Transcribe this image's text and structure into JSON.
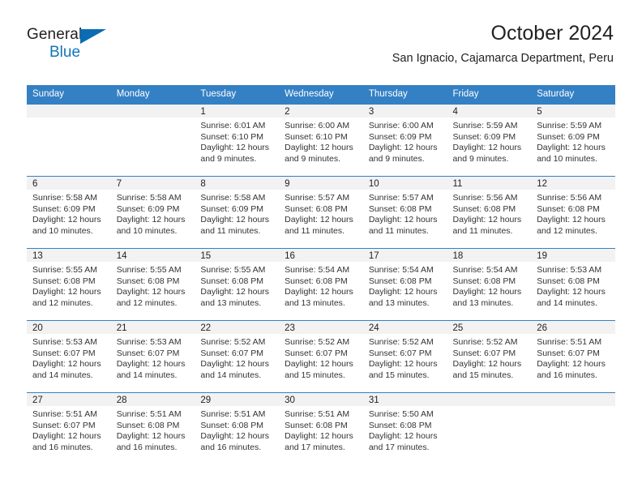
{
  "brand": {
    "name_primary": "General",
    "name_secondary": "Blue",
    "triangle_color": "#0a6cb4",
    "secondary_color": "#1175bc"
  },
  "header": {
    "title": "October 2024",
    "subtitle": "San Ignacio, Cajamarca Department, Peru"
  },
  "theme": {
    "header_blue": "#3480c4",
    "daynum_band": "#f2f2f2",
    "text": "#333333"
  },
  "weekday_headers": [
    "Sunday",
    "Monday",
    "Tuesday",
    "Wednesday",
    "Thursday",
    "Friday",
    "Saturday"
  ],
  "weeks": [
    [
      {
        "day": "",
        "sunrise": "",
        "sunset": "",
        "daylight_1": "",
        "daylight_2": ""
      },
      {
        "day": "",
        "sunrise": "",
        "sunset": "",
        "daylight_1": "",
        "daylight_2": ""
      },
      {
        "day": "1",
        "sunrise": "Sunrise: 6:01 AM",
        "sunset": "Sunset: 6:10 PM",
        "daylight_1": "Daylight: 12 hours",
        "daylight_2": "and 9 minutes."
      },
      {
        "day": "2",
        "sunrise": "Sunrise: 6:00 AM",
        "sunset": "Sunset: 6:10 PM",
        "daylight_1": "Daylight: 12 hours",
        "daylight_2": "and 9 minutes."
      },
      {
        "day": "3",
        "sunrise": "Sunrise: 6:00 AM",
        "sunset": "Sunset: 6:09 PM",
        "daylight_1": "Daylight: 12 hours",
        "daylight_2": "and 9 minutes."
      },
      {
        "day": "4",
        "sunrise": "Sunrise: 5:59 AM",
        "sunset": "Sunset: 6:09 PM",
        "daylight_1": "Daylight: 12 hours",
        "daylight_2": "and 9 minutes."
      },
      {
        "day": "5",
        "sunrise": "Sunrise: 5:59 AM",
        "sunset": "Sunset: 6:09 PM",
        "daylight_1": "Daylight: 12 hours",
        "daylight_2": "and 10 minutes."
      }
    ],
    [
      {
        "day": "6",
        "sunrise": "Sunrise: 5:58 AM",
        "sunset": "Sunset: 6:09 PM",
        "daylight_1": "Daylight: 12 hours",
        "daylight_2": "and 10 minutes."
      },
      {
        "day": "7",
        "sunrise": "Sunrise: 5:58 AM",
        "sunset": "Sunset: 6:09 PM",
        "daylight_1": "Daylight: 12 hours",
        "daylight_2": "and 10 minutes."
      },
      {
        "day": "8",
        "sunrise": "Sunrise: 5:58 AM",
        "sunset": "Sunset: 6:09 PM",
        "daylight_1": "Daylight: 12 hours",
        "daylight_2": "and 11 minutes."
      },
      {
        "day": "9",
        "sunrise": "Sunrise: 5:57 AM",
        "sunset": "Sunset: 6:08 PM",
        "daylight_1": "Daylight: 12 hours",
        "daylight_2": "and 11 minutes."
      },
      {
        "day": "10",
        "sunrise": "Sunrise: 5:57 AM",
        "sunset": "Sunset: 6:08 PM",
        "daylight_1": "Daylight: 12 hours",
        "daylight_2": "and 11 minutes."
      },
      {
        "day": "11",
        "sunrise": "Sunrise: 5:56 AM",
        "sunset": "Sunset: 6:08 PM",
        "daylight_1": "Daylight: 12 hours",
        "daylight_2": "and 11 minutes."
      },
      {
        "day": "12",
        "sunrise": "Sunrise: 5:56 AM",
        "sunset": "Sunset: 6:08 PM",
        "daylight_1": "Daylight: 12 hours",
        "daylight_2": "and 12 minutes."
      }
    ],
    [
      {
        "day": "13",
        "sunrise": "Sunrise: 5:55 AM",
        "sunset": "Sunset: 6:08 PM",
        "daylight_1": "Daylight: 12 hours",
        "daylight_2": "and 12 minutes."
      },
      {
        "day": "14",
        "sunrise": "Sunrise: 5:55 AM",
        "sunset": "Sunset: 6:08 PM",
        "daylight_1": "Daylight: 12 hours",
        "daylight_2": "and 12 minutes."
      },
      {
        "day": "15",
        "sunrise": "Sunrise: 5:55 AM",
        "sunset": "Sunset: 6:08 PM",
        "daylight_1": "Daylight: 12 hours",
        "daylight_2": "and 13 minutes."
      },
      {
        "day": "16",
        "sunrise": "Sunrise: 5:54 AM",
        "sunset": "Sunset: 6:08 PM",
        "daylight_1": "Daylight: 12 hours",
        "daylight_2": "and 13 minutes."
      },
      {
        "day": "17",
        "sunrise": "Sunrise: 5:54 AM",
        "sunset": "Sunset: 6:08 PM",
        "daylight_1": "Daylight: 12 hours",
        "daylight_2": "and 13 minutes."
      },
      {
        "day": "18",
        "sunrise": "Sunrise: 5:54 AM",
        "sunset": "Sunset: 6:08 PM",
        "daylight_1": "Daylight: 12 hours",
        "daylight_2": "and 13 minutes."
      },
      {
        "day": "19",
        "sunrise": "Sunrise: 5:53 AM",
        "sunset": "Sunset: 6:08 PM",
        "daylight_1": "Daylight: 12 hours",
        "daylight_2": "and 14 minutes."
      }
    ],
    [
      {
        "day": "20",
        "sunrise": "Sunrise: 5:53 AM",
        "sunset": "Sunset: 6:07 PM",
        "daylight_1": "Daylight: 12 hours",
        "daylight_2": "and 14 minutes."
      },
      {
        "day": "21",
        "sunrise": "Sunrise: 5:53 AM",
        "sunset": "Sunset: 6:07 PM",
        "daylight_1": "Daylight: 12 hours",
        "daylight_2": "and 14 minutes."
      },
      {
        "day": "22",
        "sunrise": "Sunrise: 5:52 AM",
        "sunset": "Sunset: 6:07 PM",
        "daylight_1": "Daylight: 12 hours",
        "daylight_2": "and 14 minutes."
      },
      {
        "day": "23",
        "sunrise": "Sunrise: 5:52 AM",
        "sunset": "Sunset: 6:07 PM",
        "daylight_1": "Daylight: 12 hours",
        "daylight_2": "and 15 minutes."
      },
      {
        "day": "24",
        "sunrise": "Sunrise: 5:52 AM",
        "sunset": "Sunset: 6:07 PM",
        "daylight_1": "Daylight: 12 hours",
        "daylight_2": "and 15 minutes."
      },
      {
        "day": "25",
        "sunrise": "Sunrise: 5:52 AM",
        "sunset": "Sunset: 6:07 PM",
        "daylight_1": "Daylight: 12 hours",
        "daylight_2": "and 15 minutes."
      },
      {
        "day": "26",
        "sunrise": "Sunrise: 5:51 AM",
        "sunset": "Sunset: 6:07 PM",
        "daylight_1": "Daylight: 12 hours",
        "daylight_2": "and 16 minutes."
      }
    ],
    [
      {
        "day": "27",
        "sunrise": "Sunrise: 5:51 AM",
        "sunset": "Sunset: 6:07 PM",
        "daylight_1": "Daylight: 12 hours",
        "daylight_2": "and 16 minutes."
      },
      {
        "day": "28",
        "sunrise": "Sunrise: 5:51 AM",
        "sunset": "Sunset: 6:08 PM",
        "daylight_1": "Daylight: 12 hours",
        "daylight_2": "and 16 minutes."
      },
      {
        "day": "29",
        "sunrise": "Sunrise: 5:51 AM",
        "sunset": "Sunset: 6:08 PM",
        "daylight_1": "Daylight: 12 hours",
        "daylight_2": "and 16 minutes."
      },
      {
        "day": "30",
        "sunrise": "Sunrise: 5:51 AM",
        "sunset": "Sunset: 6:08 PM",
        "daylight_1": "Daylight: 12 hours",
        "daylight_2": "and 17 minutes."
      },
      {
        "day": "31",
        "sunrise": "Sunrise: 5:50 AM",
        "sunset": "Sunset: 6:08 PM",
        "daylight_1": "Daylight: 12 hours",
        "daylight_2": "and 17 minutes."
      },
      {
        "day": "",
        "sunrise": "",
        "sunset": "",
        "daylight_1": "",
        "daylight_2": ""
      },
      {
        "day": "",
        "sunrise": "",
        "sunset": "",
        "daylight_1": "",
        "daylight_2": ""
      }
    ]
  ]
}
